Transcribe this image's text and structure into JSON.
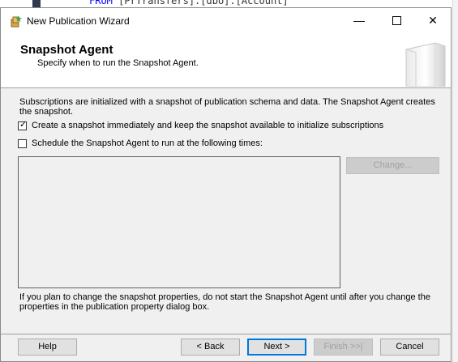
{
  "background": {
    "code_keyword": "FROM",
    "code_text": " [PrTransfers].[dbo].[Account]"
  },
  "window": {
    "title": "New Publication Wizard",
    "controls": {
      "minimize": "—",
      "close": "✕"
    }
  },
  "header": {
    "title": "Snapshot Agent",
    "subtitle": "Specify when to run the Snapshot Agent."
  },
  "content": {
    "description": "Subscriptions are initialized with a snapshot of publication schema and data. The Snapshot Agent creates the snapshot.",
    "create_snapshot": {
      "label": "Create a snapshot immediately and keep the snapshot available to initialize subscriptions",
      "checked": true
    },
    "schedule": {
      "label": "Schedule the Snapshot Agent to run at the following times:",
      "checked": false
    },
    "change_button": "Change...",
    "note": "If you plan to change the snapshot properties, do not start the Snapshot Agent until after you change the properties in the publication property dialog box."
  },
  "footer": {
    "help": "Help",
    "back": "< Back",
    "next": "Next >",
    "finish": "Finish >>|",
    "cancel": "Cancel"
  },
  "colors": {
    "accent": "#0078d7",
    "dialog_bg": "#f0f0f0",
    "disabled_text": "#a0a0a0"
  }
}
